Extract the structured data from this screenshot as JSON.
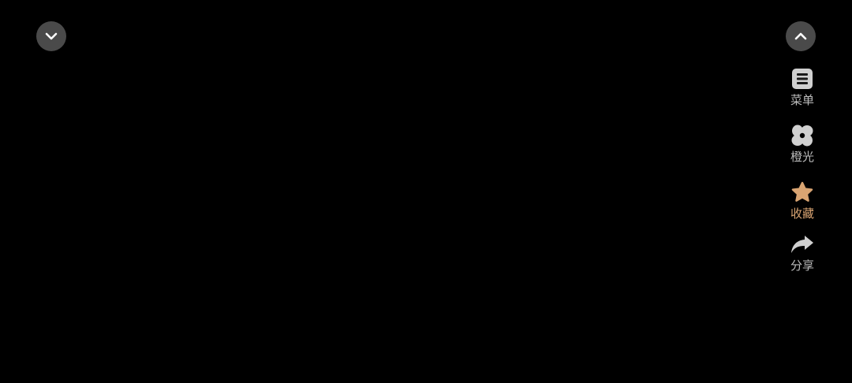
{
  "controls": {
    "collapse_icon": "chevron-down-icon",
    "expand_icon": "chevron-up-icon"
  },
  "actions": [
    {
      "label": "菜单",
      "icon": "menu-list-icon",
      "color": "#d0d0d0"
    },
    {
      "label": "橙光",
      "icon": "pinwheel-logo-icon",
      "color": "#d0d0d0"
    },
    {
      "label": "收藏",
      "icon": "star-icon",
      "color": "#d9a472",
      "active": true
    },
    {
      "label": "分享",
      "icon": "share-arrow-icon",
      "color": "#d0d0d0"
    }
  ],
  "colors": {
    "background": "#000000",
    "button_bg": "#4a4a4a",
    "accent": "#d9a472",
    "label": "#bdbdbd"
  }
}
